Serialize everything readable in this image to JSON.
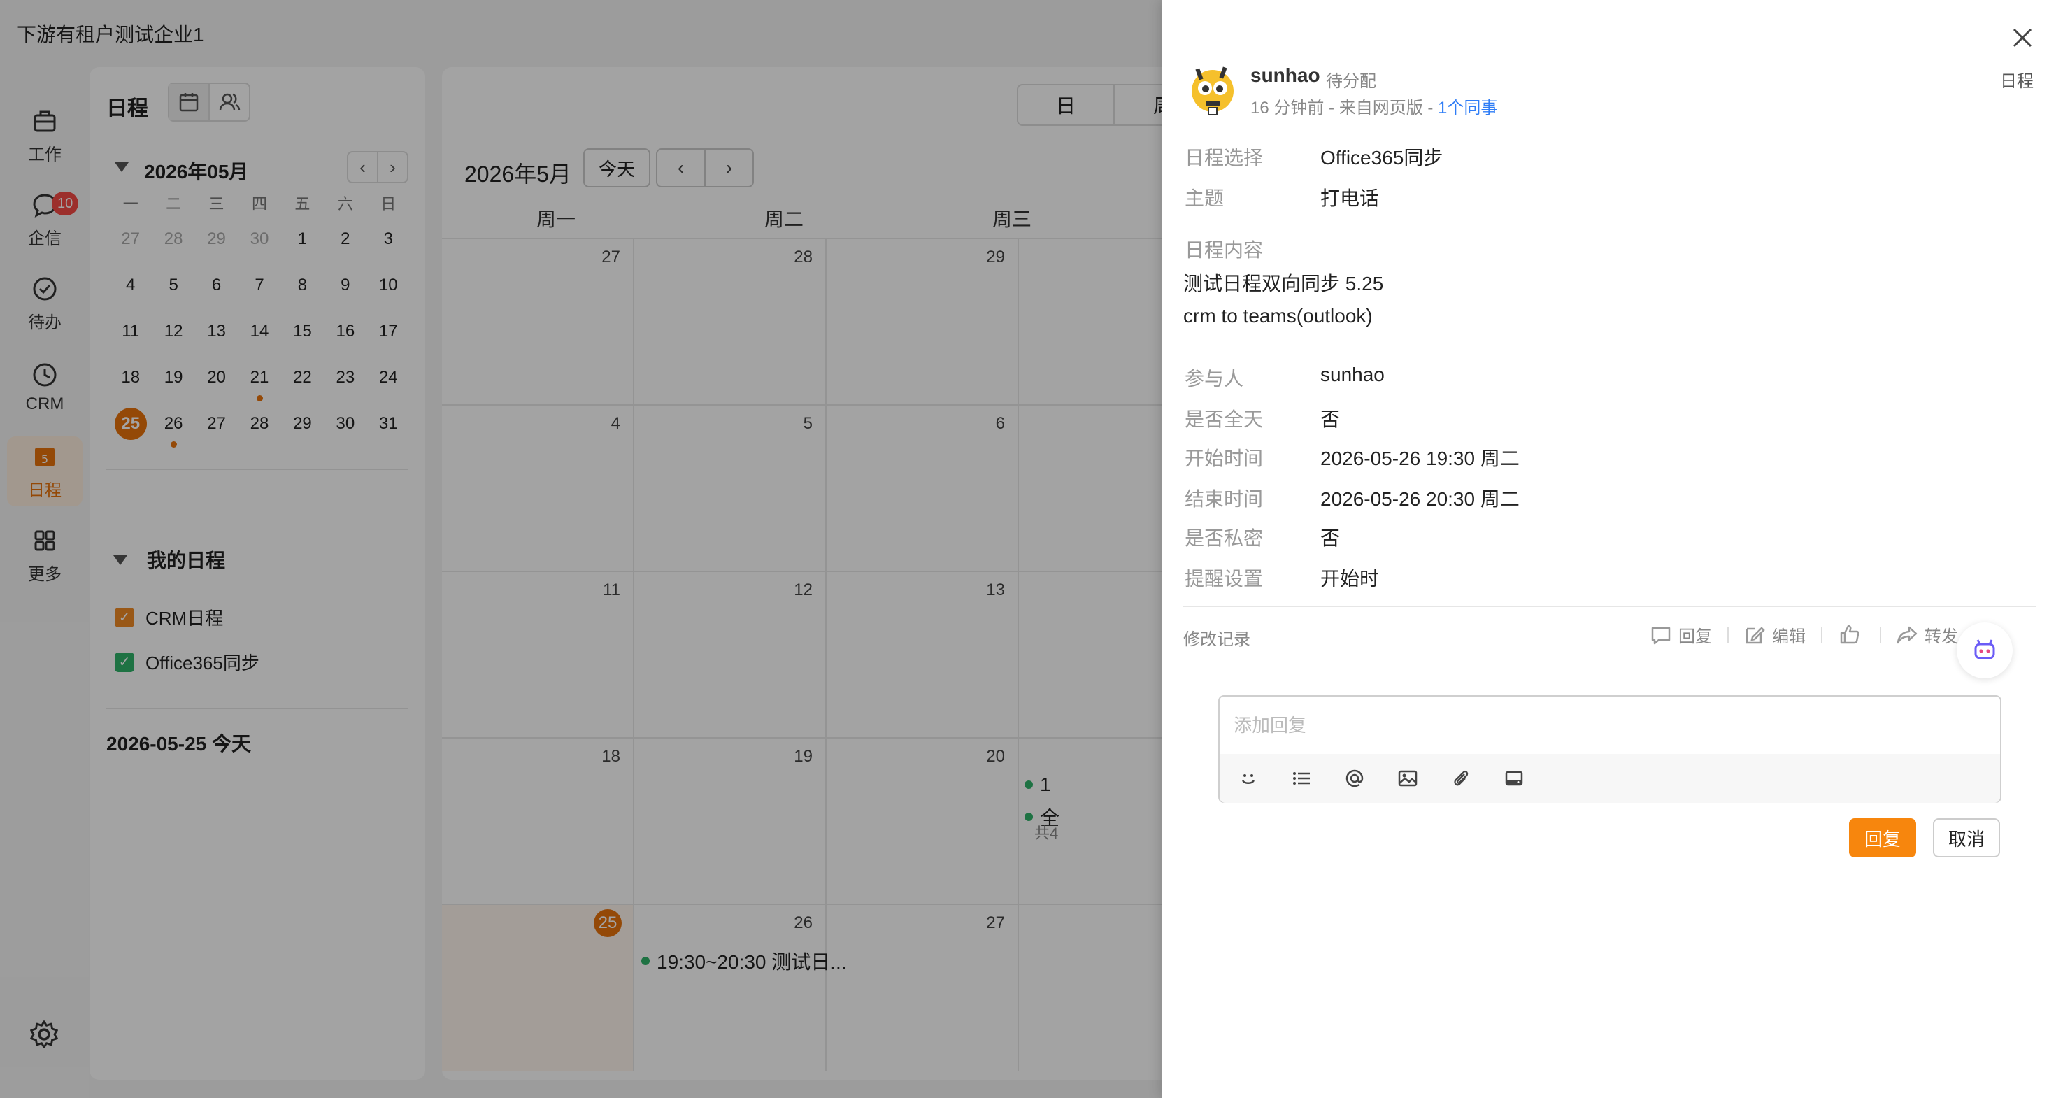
{
  "app": {
    "company": "下游有租户测试企业1"
  },
  "nav": {
    "items": [
      {
        "label": "工作"
      },
      {
        "label": "企信",
        "badge": "10"
      },
      {
        "label": "待办"
      },
      {
        "label": "CRM"
      },
      {
        "label": "日程",
        "icon_text": "5"
      },
      {
        "label": "更多"
      }
    ]
  },
  "side": {
    "title": "日程",
    "month": "2026年05月",
    "weekdays": [
      "一",
      "二",
      "三",
      "四",
      "五",
      "六",
      "日"
    ],
    "weeks": [
      [
        "27",
        "28",
        "29",
        "30",
        "1",
        "2",
        "3"
      ],
      [
        "4",
        "5",
        "6",
        "7",
        "8",
        "9",
        "10"
      ],
      [
        "11",
        "12",
        "13",
        "14",
        "15",
        "16",
        "17"
      ],
      [
        "18",
        "19",
        "20",
        "21",
        "22",
        "23",
        "24"
      ],
      [
        "25",
        "26",
        "27",
        "28",
        "29",
        "30",
        "31"
      ]
    ],
    "my_calendars_title": "我的日程",
    "calendars": [
      {
        "label": "CRM日程",
        "color": "#f08a24"
      },
      {
        "label": "Office365同步",
        "color": "#2fb36a"
      }
    ],
    "today_label": "2026-05-25 今天"
  },
  "main": {
    "views": [
      "日",
      "周"
    ],
    "month_title": "2026年5月",
    "today_btn": "今天",
    "weekday_headers": [
      "周一",
      "周二",
      "周三"
    ],
    "rows": [
      [
        "27",
        "28",
        "29"
      ],
      [
        "4",
        "5",
        "6"
      ],
      [
        "11",
        "12",
        "13"
      ],
      [
        "18",
        "19",
        "20"
      ],
      [
        "25",
        "26",
        "27"
      ]
    ],
    "event_text": "19:30~20:30   测试日...",
    "peek": {
      "line1": "1",
      "line2": "全",
      "more": "共4"
    }
  },
  "detail": {
    "user": "sunhao",
    "status": "待分配",
    "meta_prefix": "16 分钟前 - 来自网页版 - ",
    "meta_link": "1个同事",
    "tag": "日程",
    "fields": {
      "calendar_label": "日程选择",
      "calendar_value": "Office365同步",
      "subject_label": "主题",
      "subject_value": "打电话",
      "content_label": "日程内容",
      "content_line1": "测试日程双向同步 5.25",
      "content_line2": "crm to teams(outlook)",
      "participants_label": "参与人",
      "participants_value": "sunhao",
      "allday_label": "是否全天",
      "allday_value": "否",
      "start_label": "开始时间",
      "start_value": "2026-05-26 19:30 周二",
      "end_label": "结束时间",
      "end_value": "2026-05-26 20:30 周二",
      "private_label": "是否私密",
      "private_value": "否",
      "reminder_label": "提醒设置",
      "reminder_value": "开始时"
    },
    "history": "修改记录",
    "actions": {
      "reply": "回复",
      "edit": "编辑",
      "forward": "转发"
    },
    "reply_placeholder": "添加回复",
    "reply_btn": "回复",
    "cancel_btn": "取消"
  }
}
